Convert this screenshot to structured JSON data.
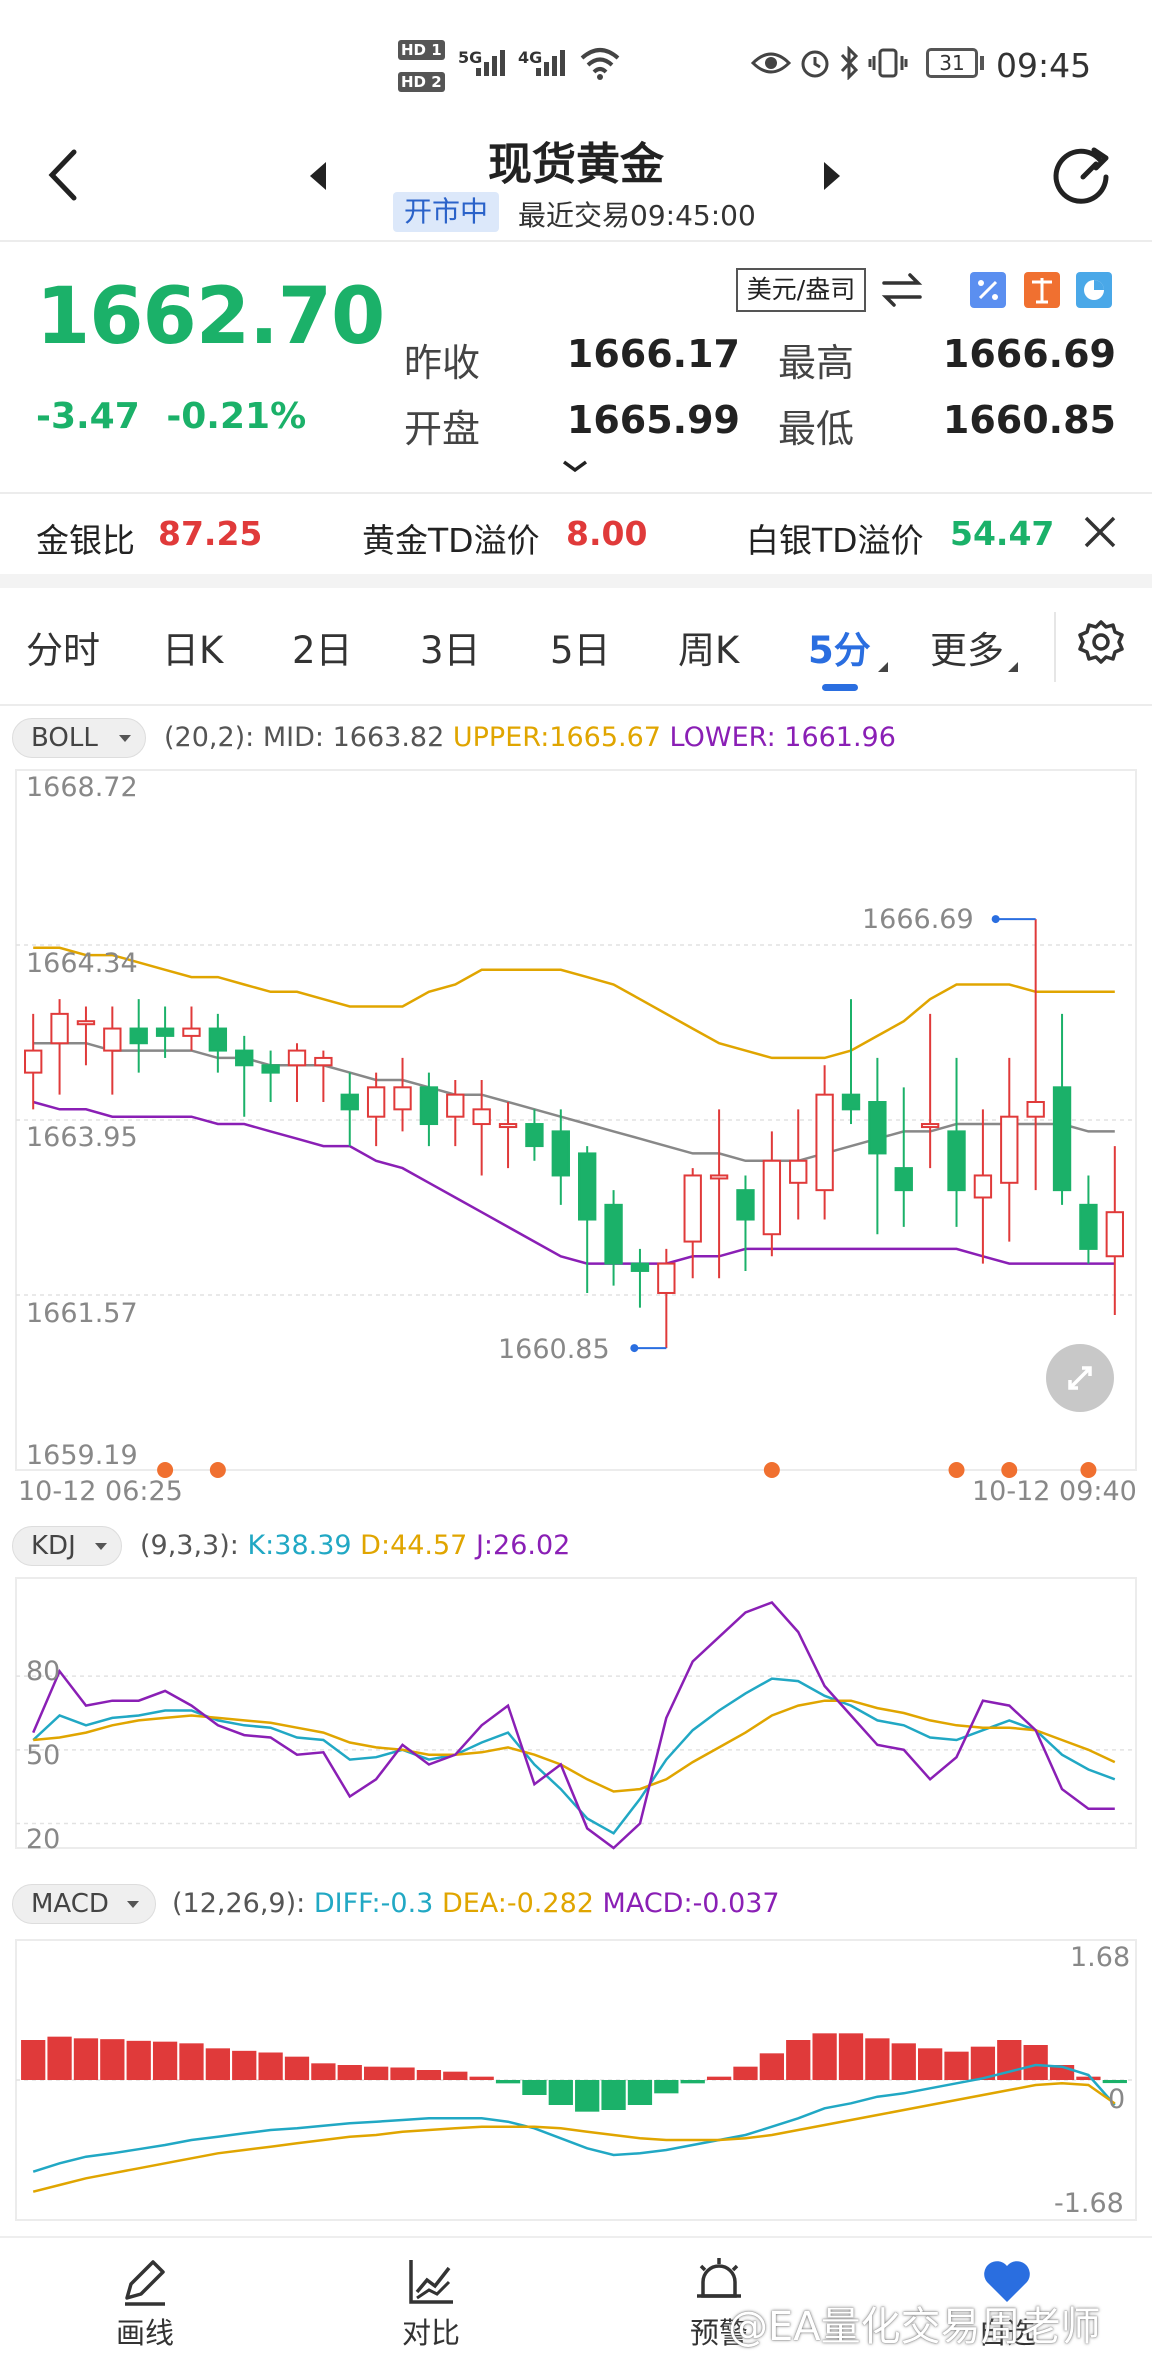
{
  "status_bar": {
    "time": "09:45",
    "battery": "31",
    "sim1": "HD 1",
    "sim2": "HD 2",
    "net1": "5G",
    "net2": "4G"
  },
  "header": {
    "title": "现货黄金",
    "market_status": "开市中",
    "last_trade": "最近交易09:45:00"
  },
  "quote": {
    "price": "1662.70",
    "change": "-3.47",
    "change_pct": "-0.21%",
    "unit": "美元/盎司",
    "fields": [
      {
        "label": "昨收",
        "value": "1666.17"
      },
      {
        "label": "最高",
        "value": "1666.69"
      },
      {
        "label": "开盘",
        "value": "1665.99"
      },
      {
        "label": "最低",
        "value": "1660.85"
      }
    ]
  },
  "ratios": [
    {
      "label": "金银比",
      "value": "87.25",
      "color": "#e03a3a"
    },
    {
      "label": "黄金TD溢价",
      "value": "8.00",
      "color": "#e03a3a"
    },
    {
      "label": "白银TD溢价",
      "value": "54.47",
      "color": "#1bb169"
    }
  ],
  "tabs": [
    "分时",
    "日K",
    "2日",
    "3日",
    "5日",
    "周K",
    "5分",
    "更多"
  ],
  "active_tab": "5分",
  "boll": {
    "name": "BOLL",
    "params": "(20,2):",
    "mid_label": "MID:",
    "mid": "1663.82",
    "upper_label": "UPPER:",
    "upper": "1665.67",
    "lower_label": "LOWER:",
    "lower": "1661.96",
    "y_ticks": [
      "1668.72",
      "1664.34",
      "1663.95",
      "1661.57",
      "1659.19"
    ],
    "high_marker": "1666.69",
    "low_marker": "1660.85",
    "time_start": "10-12 06:25",
    "time_end": "10-12 09:40"
  },
  "kdj": {
    "name": "KDJ",
    "params": "(9,3,3):",
    "k_label": "K:",
    "k": "38.39",
    "d_label": "D:",
    "d": "44.57",
    "j_label": "J:",
    "j": "26.02",
    "y_ticks": [
      "80",
      "50",
      "20"
    ]
  },
  "macd": {
    "name": "MACD",
    "params": "(12,26,9):",
    "diff_label": "DIFF:",
    "diff": "-0.3",
    "dea_label": "DEA:",
    "dea": "-0.282",
    "macd_label": "MACD:",
    "macd": "-0.037",
    "y_ticks": [
      "1.68",
      "0",
      "-1.68"
    ]
  },
  "bottom_nav": [
    "画线",
    "对比",
    "预警",
    "自选"
  ],
  "watermark": "@EA量化交易周老师",
  "colors": {
    "up": "#e03a3a",
    "down": "#1bb169",
    "accent": "#2a6ee0",
    "upper": "#e0a500",
    "lower": "#8a1fb5",
    "mid": "#888888"
  },
  "chart_data": [
    {
      "type": "candlestick",
      "title": "BOLL(20,2)",
      "ylim": [
        1659.19,
        1668.72
      ],
      "y_ticks": [
        1668.72,
        1664.34,
        1663.95,
        1661.57,
        1659.19
      ],
      "candles": [
        {
          "o": 1664.6,
          "c": 1664.9,
          "h": 1665.4,
          "l": 1664.1
        },
        {
          "o": 1665.0,
          "c": 1665.4,
          "h": 1665.6,
          "l": 1664.3
        },
        {
          "o": 1665.3,
          "c": 1665.3,
          "h": 1665.5,
          "l": 1664.7
        },
        {
          "o": 1664.9,
          "c": 1665.2,
          "h": 1665.5,
          "l": 1664.3
        },
        {
          "o": 1665.2,
          "c": 1665.0,
          "h": 1665.6,
          "l": 1664.6
        },
        {
          "o": 1665.2,
          "c": 1665.1,
          "h": 1665.5,
          "l": 1664.8
        },
        {
          "o": 1665.1,
          "c": 1665.2,
          "h": 1665.5,
          "l": 1664.9
        },
        {
          "o": 1665.2,
          "c": 1664.9,
          "h": 1665.4,
          "l": 1664.6
        },
        {
          "o": 1664.9,
          "c": 1664.7,
          "h": 1665.1,
          "l": 1664.0
        },
        {
          "o": 1664.7,
          "c": 1664.6,
          "h": 1664.9,
          "l": 1664.2
        },
        {
          "o": 1664.7,
          "c": 1664.9,
          "h": 1665.0,
          "l": 1664.2
        },
        {
          "o": 1664.7,
          "c": 1664.8,
          "h": 1664.9,
          "l": 1664.2
        },
        {
          "o": 1664.3,
          "c": 1664.1,
          "h": 1664.6,
          "l": 1663.6
        },
        {
          "o": 1664.0,
          "c": 1664.4,
          "h": 1664.6,
          "l": 1663.6
        },
        {
          "o": 1664.1,
          "c": 1664.4,
          "h": 1664.8,
          "l": 1663.8
        },
        {
          "o": 1664.4,
          "c": 1663.9,
          "h": 1664.6,
          "l": 1663.6
        },
        {
          "o": 1664.0,
          "c": 1664.3,
          "h": 1664.5,
          "l": 1663.6
        },
        {
          "o": 1663.9,
          "c": 1664.1,
          "h": 1664.5,
          "l": 1663.2
        },
        {
          "o": 1663.9,
          "c": 1663.9,
          "h": 1664.2,
          "l": 1663.3
        },
        {
          "o": 1663.9,
          "c": 1663.6,
          "h": 1664.1,
          "l": 1663.4
        },
        {
          "o": 1663.8,
          "c": 1663.2,
          "h": 1664.1,
          "l": 1662.8
        },
        {
          "o": 1663.5,
          "c": 1662.6,
          "h": 1663.6,
          "l": 1661.6
        },
        {
          "o": 1662.8,
          "c": 1662.0,
          "h": 1663.0,
          "l": 1661.7
        },
        {
          "o": 1662.0,
          "c": 1661.9,
          "h": 1662.2,
          "l": 1661.4
        },
        {
          "o": 1661.6,
          "c": 1662.0,
          "h": 1662.2,
          "l": 1660.85
        },
        {
          "o": 1662.3,
          "c": 1663.2,
          "h": 1663.3,
          "l": 1661.8
        },
        {
          "o": 1663.2,
          "c": 1663.2,
          "h": 1664.1,
          "l": 1661.8
        },
        {
          "o": 1663.0,
          "c": 1662.6,
          "h": 1663.2,
          "l": 1661.9
        },
        {
          "o": 1662.4,
          "c": 1663.4,
          "h": 1663.8,
          "l": 1662.1
        },
        {
          "o": 1663.1,
          "c": 1663.4,
          "h": 1664.1,
          "l": 1662.6
        },
        {
          "o": 1663.0,
          "c": 1664.3,
          "h": 1664.7,
          "l": 1662.6
        },
        {
          "o": 1664.3,
          "c": 1664.1,
          "h": 1665.6,
          "l": 1663.9
        },
        {
          "o": 1664.2,
          "c": 1663.5,
          "h": 1664.8,
          "l": 1662.4
        },
        {
          "o": 1663.3,
          "c": 1663.0,
          "h": 1664.4,
          "l": 1662.5
        },
        {
          "o": 1663.9,
          "c": 1663.9,
          "h": 1665.4,
          "l": 1663.3
        },
        {
          "o": 1663.8,
          "c": 1663.0,
          "h": 1664.8,
          "l": 1662.5
        },
        {
          "o": 1662.9,
          "c": 1663.2,
          "h": 1664.1,
          "l": 1662.0
        },
        {
          "o": 1663.1,
          "c": 1664.0,
          "h": 1664.8,
          "l": 1662.3
        },
        {
          "o": 1664.0,
          "c": 1664.2,
          "h": 1666.69,
          "l": 1663.0
        },
        {
          "o": 1664.4,
          "c": 1663.0,
          "h": 1665.4,
          "l": 1662.8
        },
        {
          "o": 1662.8,
          "c": 1662.2,
          "h": 1663.2,
          "l": 1662.0
        },
        {
          "o": 1662.1,
          "c": 1662.7,
          "h": 1663.6,
          "l": 1661.3
        }
      ],
      "upper": [
        1666.3,
        1666.3,
        1666.2,
        1666.2,
        1666.1,
        1666.0,
        1665.9,
        1665.9,
        1665.8,
        1665.7,
        1665.7,
        1665.6,
        1665.5,
        1665.5,
        1665.5,
        1665.7,
        1665.8,
        1666.0,
        1666.0,
        1666.0,
        1666.0,
        1665.9,
        1665.8,
        1665.6,
        1665.4,
        1665.2,
        1665.0,
        1664.9,
        1664.8,
        1664.8,
        1664.8,
        1664.9,
        1665.1,
        1665.3,
        1665.6,
        1665.8,
        1665.8,
        1665.8,
        1665.7,
        1665.7,
        1665.7,
        1665.7
      ],
      "mid": [
        1665.0,
        1665.0,
        1665.0,
        1664.9,
        1664.9,
        1664.9,
        1664.9,
        1664.8,
        1664.8,
        1664.7,
        1664.7,
        1664.7,
        1664.6,
        1664.5,
        1664.5,
        1664.4,
        1664.3,
        1664.3,
        1664.2,
        1664.1,
        1664.0,
        1663.9,
        1663.8,
        1663.7,
        1663.6,
        1663.5,
        1663.5,
        1663.4,
        1663.4,
        1663.4,
        1663.5,
        1663.6,
        1663.7,
        1663.8,
        1663.8,
        1663.9,
        1663.9,
        1663.9,
        1663.9,
        1663.9,
        1663.8,
        1663.8
      ],
      "lower": [
        1664.2,
        1664.1,
        1664.1,
        1664.0,
        1664.0,
        1664.0,
        1664.0,
        1663.9,
        1663.9,
        1663.8,
        1663.7,
        1663.6,
        1663.6,
        1663.4,
        1663.3,
        1663.1,
        1662.9,
        1662.7,
        1662.5,
        1662.3,
        1662.1,
        1662.0,
        1662.0,
        1662.0,
        1662.0,
        1662.1,
        1662.1,
        1662.2,
        1662.2,
        1662.2,
        1662.2,
        1662.2,
        1662.2,
        1662.2,
        1662.2,
        1662.2,
        1662.1,
        1662.0,
        1662.0,
        1662.0,
        1662.0,
        1662.0
      ]
    },
    {
      "type": "line",
      "title": "KDJ(9,3,3)",
      "ylim": [
        10,
        120
      ],
      "series": [
        {
          "name": "K",
          "values": [
            54,
            64,
            60,
            63,
            64,
            66,
            66,
            62,
            60,
            59,
            55,
            54,
            46,
            47,
            50,
            46,
            48,
            53,
            57,
            44,
            34,
            22,
            16,
            30,
            46,
            58,
            66,
            73,
            79,
            78,
            72,
            68,
            62,
            60,
            55,
            54,
            58,
            62,
            58,
            48,
            42,
            38
          ]
        },
        {
          "name": "D",
          "values": [
            54,
            55,
            57,
            60,
            62,
            63,
            64,
            63,
            62,
            61,
            59,
            57,
            53,
            51,
            50,
            48,
            48,
            49,
            51,
            48,
            44,
            38,
            33,
            34,
            38,
            45,
            51,
            57,
            64,
            68,
            70,
            70,
            67,
            65,
            62,
            60,
            59,
            59,
            58,
            54,
            50,
            45
          ]
        },
        {
          "name": "J",
          "values": [
            57,
            82,
            68,
            70,
            70,
            74,
            68,
            60,
            56,
            55,
            48,
            49,
            31,
            38,
            52,
            44,
            48,
            60,
            68,
            36,
            44,
            18,
            10,
            20,
            63,
            86,
            96,
            106,
            110,
            98,
            76,
            64,
            52,
            50,
            38,
            47,
            70,
            68,
            58,
            34,
            26,
            26
          ]
        }
      ]
    },
    {
      "type": "bar",
      "title": "MACD(12,26,9)",
      "ylim": [
        -1.68,
        1.68
      ],
      "series": [
        {
          "name": "MACD",
          "values": [
            0.48,
            0.52,
            0.5,
            0.49,
            0.47,
            0.46,
            0.44,
            0.38,
            0.35,
            0.33,
            0.28,
            0.2,
            0.18,
            0.16,
            0.15,
            0.12,
            0.1,
            0.04,
            -0.04,
            -0.18,
            -0.3,
            -0.38,
            -0.36,
            -0.3,
            -0.16,
            -0.04,
            0.04,
            0.16,
            0.32,
            0.48,
            0.56,
            0.56,
            0.5,
            0.44,
            0.38,
            0.34,
            0.4,
            0.48,
            0.42,
            0.18,
            0.04,
            -0.037
          ]
        },
        {
          "name": "DIFF",
          "values": [
            -1.1,
            -1.0,
            -0.92,
            -0.88,
            -0.83,
            -0.78,
            -0.72,
            -0.68,
            -0.64,
            -0.6,
            -0.58,
            -0.55,
            -0.52,
            -0.5,
            -0.48,
            -0.46,
            -0.46,
            -0.46,
            -0.5,
            -0.58,
            -0.7,
            -0.82,
            -0.9,
            -0.88,
            -0.84,
            -0.78,
            -0.72,
            -0.66,
            -0.56,
            -0.46,
            -0.34,
            -0.28,
            -0.2,
            -0.16,
            -0.1,
            -0.04,
            0.02,
            0.1,
            0.18,
            0.16,
            0.06,
            -0.3
          ]
        },
        {
          "name": "DEA",
          "values": [
            -1.34,
            -1.26,
            -1.18,
            -1.12,
            -1.06,
            -1.0,
            -0.94,
            -0.88,
            -0.84,
            -0.8,
            -0.76,
            -0.72,
            -0.68,
            -0.66,
            -0.62,
            -0.6,
            -0.58,
            -0.56,
            -0.56,
            -0.56,
            -0.58,
            -0.62,
            -0.66,
            -0.7,
            -0.72,
            -0.72,
            -0.72,
            -0.7,
            -0.66,
            -0.6,
            -0.54,
            -0.48,
            -0.42,
            -0.36,
            -0.3,
            -0.24,
            -0.18,
            -0.12,
            -0.06,
            -0.04,
            -0.06,
            -0.282
          ]
        }
      ]
    }
  ]
}
